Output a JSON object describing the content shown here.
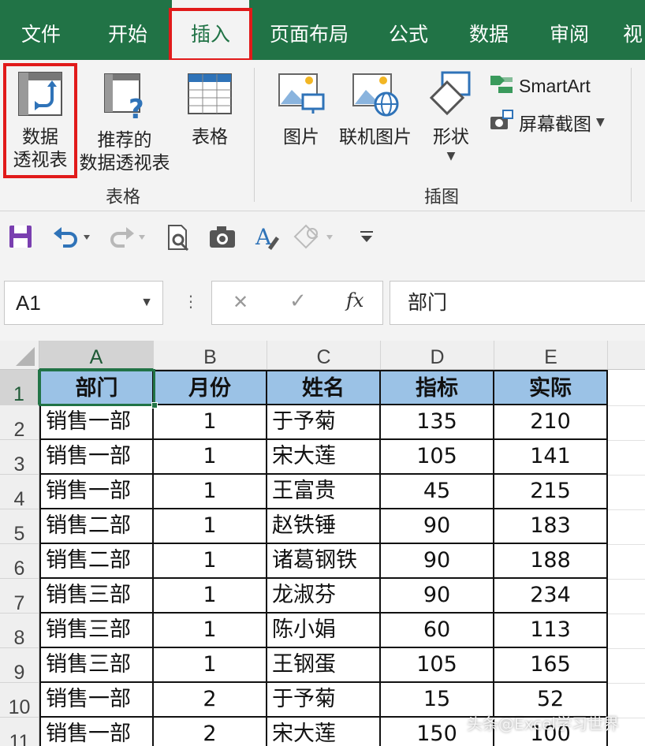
{
  "colors": {
    "ribbon_green": "#217346",
    "ribbon_bg": "#f3f3f3",
    "header_fill": "#9bc2e6",
    "highlight_red": "#e11a1a"
  },
  "ribbon_tabs": [
    "文件",
    "开始",
    "插入",
    "页面布局",
    "公式",
    "数据",
    "审阅",
    "视"
  ],
  "active_tab": "插入",
  "ribbon": {
    "groups": {
      "tables": {
        "label": "表格",
        "pivot_table": [
          "数据",
          "透视表"
        ],
        "recommended_pivot": [
          "推荐的",
          "数据透视表"
        ],
        "table": "表格"
      },
      "illustrations": {
        "label": "插图",
        "pictures": "图片",
        "online_pictures": "联机图片",
        "shapes": "形状",
        "smartart": "SmartArt",
        "screenshot": "屏幕截图"
      }
    }
  },
  "quick_access": {
    "icons": [
      "save-icon",
      "undo-icon",
      "redo-icon",
      "print-preview-icon",
      "camera-icon",
      "font-style-icon",
      "shapes-icon",
      "customize-icon"
    ]
  },
  "formula_bar": {
    "name_box": "A1",
    "cancel_glyph": "✕",
    "enter_glyph": "✓",
    "fx_glyph": "fx",
    "content": "部门"
  },
  "sheet": {
    "columns": [
      "A",
      "B",
      "C",
      "D",
      "E"
    ],
    "row_numbers": [
      "1",
      "2",
      "3",
      "4",
      "5",
      "6",
      "7",
      "8",
      "9",
      "10",
      "11"
    ],
    "headers": [
      "部门",
      "月份",
      "姓名",
      "指标",
      "实际"
    ],
    "rows": [
      [
        "销售一部",
        "1",
        "于予菊",
        "135",
        "210"
      ],
      [
        "销售一部",
        "1",
        "宋大莲",
        "105",
        "141"
      ],
      [
        "销售一部",
        "1",
        "王富贵",
        "45",
        "215"
      ],
      [
        "销售二部",
        "1",
        "赵铁锤",
        "90",
        "183"
      ],
      [
        "销售二部",
        "1",
        "诸葛钢铁",
        "90",
        "188"
      ],
      [
        "销售三部",
        "1",
        "龙淑芬",
        "90",
        "234"
      ],
      [
        "销售三部",
        "1",
        "陈小娟",
        "60",
        "113"
      ],
      [
        "销售三部",
        "1",
        "王钢蛋",
        "105",
        "165"
      ],
      [
        "销售一部",
        "2",
        "于予菊",
        "15",
        "52"
      ],
      [
        "销售一部",
        "2",
        "宋大莲",
        "150",
        "100"
      ]
    ]
  },
  "watermark": "头条@Excel学习世界"
}
